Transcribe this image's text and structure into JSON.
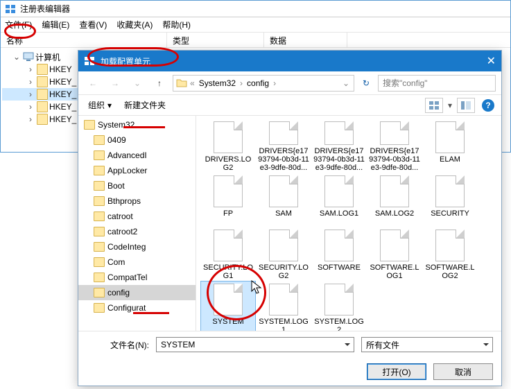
{
  "regedit": {
    "title": "注册表编辑器",
    "menu": {
      "file": "文件(F)",
      "edit": "编辑(E)",
      "view": "查看(V)",
      "fav": "收藏夹(A)",
      "help": "帮助(H)"
    },
    "cols": {
      "name": "名称",
      "type": "类型",
      "data": "数据"
    },
    "tree": {
      "root": "计算机",
      "hkeys": [
        "HKEY",
        "HKEY_",
        "HKEY_",
        "HKEY_",
        "HKEY_"
      ]
    }
  },
  "dialog": {
    "title": "加载配置单元",
    "crumbs": [
      "System32",
      "config"
    ],
    "search_placeholder": "搜索\"config\"",
    "toolbar": {
      "org": "组织",
      "newfolder": "新建文件夹"
    },
    "sidebar": [
      "System32",
      "0409",
      "AdvancedI",
      "AppLocker",
      "Boot",
      "Bthprops",
      "catroot",
      "catroot2",
      "CodeInteg",
      "Com",
      "CompatTel",
      "config",
      "Configurat"
    ],
    "files": [
      "DRIVERS.LOG2",
      "DRIVERS{e1793794-0b3d-11e3-9dfe-80d...",
      "DRIVERS{e1793794-0b3d-11e3-9dfe-80d...",
      "DRIVERS{e1793794-0b3d-11e3-9dfe-80d...",
      "ELAM",
      "FP",
      "SAM",
      "SAM.LOG1",
      "SAM.LOG2",
      "SECURITY",
      "SECURITY.LOG1",
      "SECURITY.LOG2",
      "SOFTWARE",
      "SOFTWARE.LOG1",
      "SOFTWARE.LOG2",
      "SYSTEM",
      "SYSTEM.LOG1",
      "SYSTEM.LOG2"
    ],
    "filename_label": "文件名(N):",
    "filename_value": "SYSTEM",
    "filetype_value": "所有文件",
    "open": "打开(O)",
    "cancel": "取消"
  }
}
